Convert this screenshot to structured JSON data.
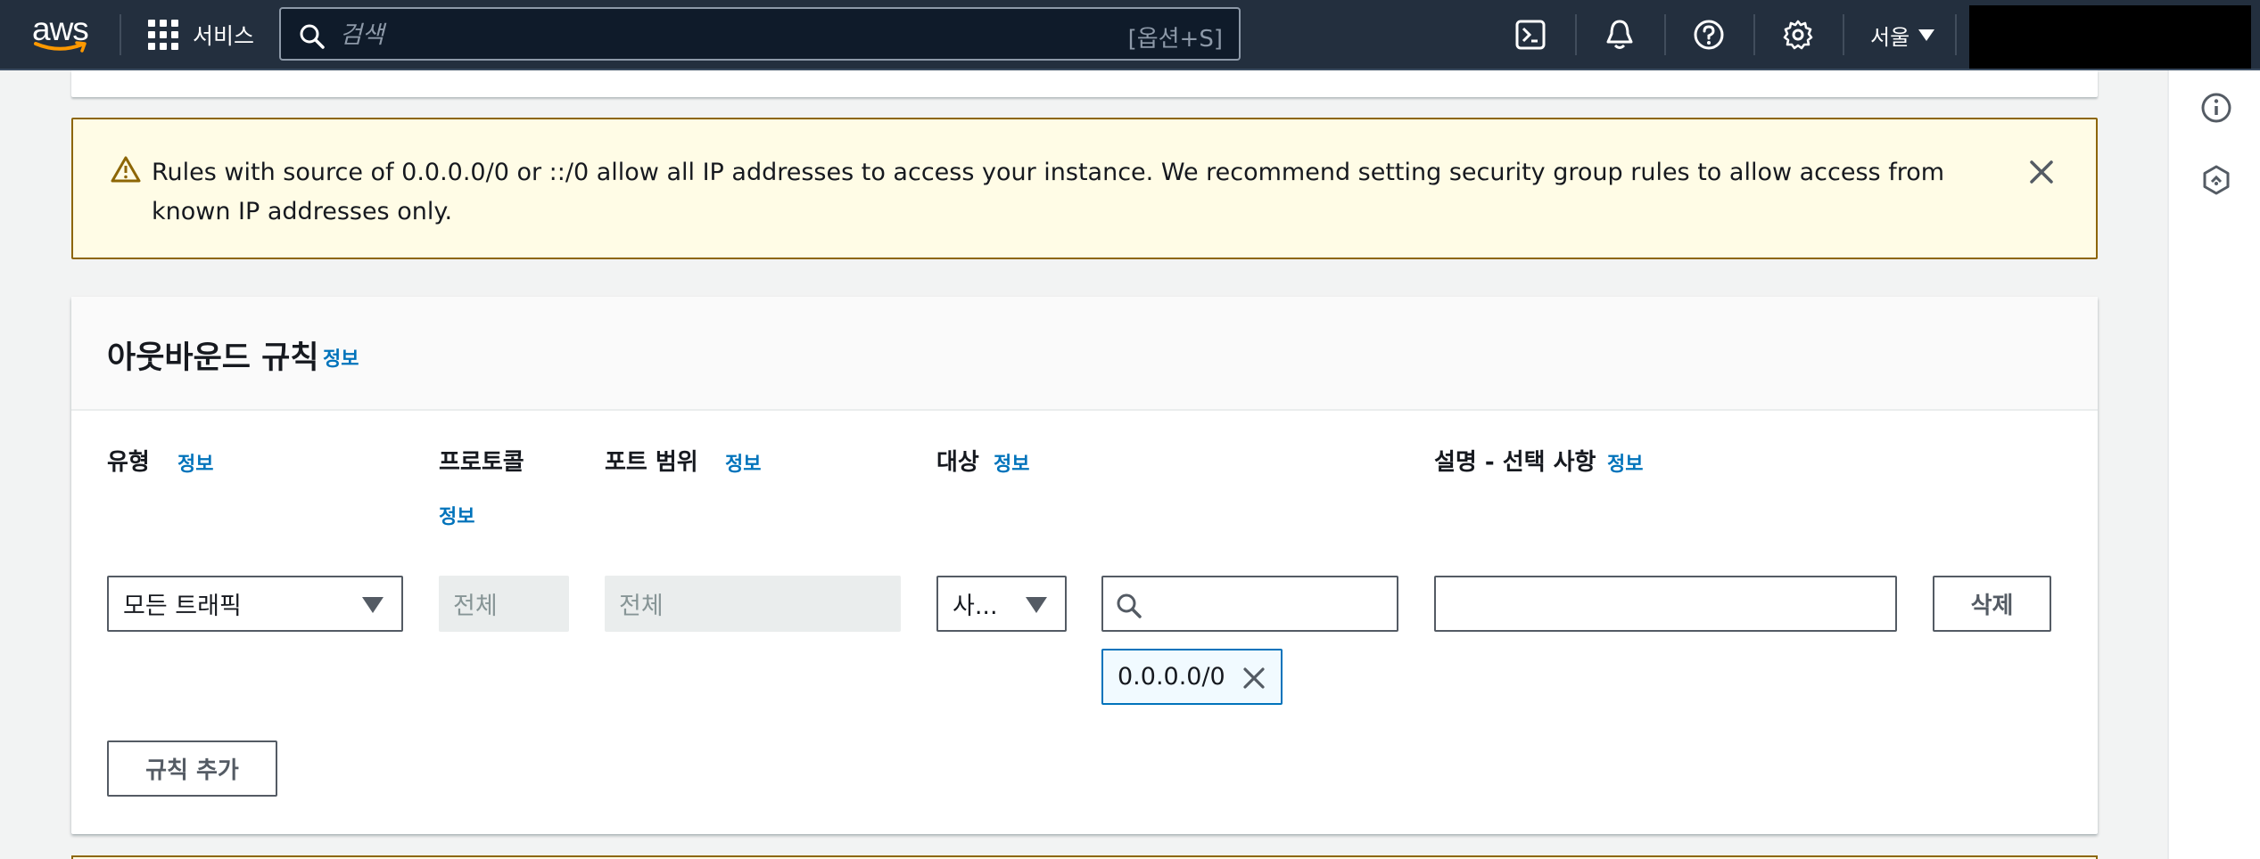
{
  "topnav": {
    "logo_text": "aws",
    "services_label": "서비스",
    "search_placeholder": "검색",
    "search_shortcut": "[옵션+S]",
    "region_label": "서울",
    "icons": [
      "cloudshell-icon",
      "bell-icon",
      "help-icon",
      "gear-icon"
    ]
  },
  "alert": {
    "message": "Rules with source of 0.0.0.0/0 or ::/0 allow all IP addresses to access your instance. We recommend setting security group rules to allow access from known IP addresses only.",
    "status_color": "#8d6605"
  },
  "outbound": {
    "title": "아웃바운드 규칙",
    "info": "정보",
    "columns": {
      "type": "유형",
      "protocol": "프로토콜",
      "port_range": "포트 범위",
      "destination": "대상",
      "description": "설명 - 선택 사항"
    },
    "rule": {
      "type_value": "모든 트래픽",
      "protocol_value": "전체",
      "port_value": "전체",
      "destination_select": "사...",
      "destination_search": "",
      "cidr_token": "0.0.0.0/0",
      "description_value": "",
      "delete_label": "삭제"
    },
    "add_rule_label": "규칙 추가"
  },
  "colors": {
    "nav_bg": "#232f3e",
    "link": "#0073bb",
    "warning_bg": "#fffce6"
  }
}
